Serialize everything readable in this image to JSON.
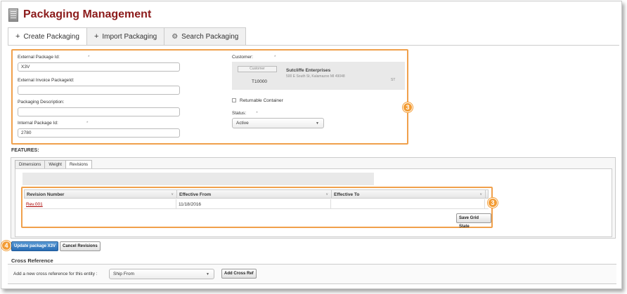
{
  "app": {
    "title": "Packaging Management",
    "logo_icon": "packaging-logo-icon"
  },
  "tabs": [
    {
      "label": "Create Packaging",
      "icon": "plus-icon"
    },
    {
      "label": "Import Packaging",
      "icon": "plus-icon"
    },
    {
      "label": "Search Packaging",
      "icon": "gear-icon"
    }
  ],
  "form": {
    "external_package_id": {
      "label": "External Package Id:",
      "required_mark": "*",
      "value": "X3V"
    },
    "external_invoice_package_id": {
      "label": "External Invoice PackageId:",
      "value": ""
    },
    "packaging_description": {
      "label": "Packaging Description:",
      "value": ""
    },
    "internal_package_id": {
      "label": "Internal Package Id:",
      "required_mark": "*",
      "value": "2780"
    },
    "customer": {
      "label": "Customer:",
      "required_mark": "*",
      "button_label": "Customer",
      "code": "T10000",
      "name": "Sutcliffe Enterprises",
      "address": "500 E South St, Kalamazoo MI 49048",
      "state": "ST"
    },
    "returnable_container": {
      "label": "Returnable Container",
      "checked": false
    },
    "status": {
      "label": "Status:",
      "required_mark": "*",
      "value": "Active"
    }
  },
  "badges": {
    "form": "3",
    "grid": "3",
    "update": "4"
  },
  "features": {
    "title": "FEATURES:",
    "tabs": [
      "Dimensions",
      "Weight",
      "Revisions"
    ],
    "active_tab": "Revisions",
    "grid": {
      "columns": [
        "Revision Number",
        "Effective From",
        "Effective To"
      ],
      "rows": [
        {
          "revision": "Rev.001",
          "effective_from": "11/18/2016",
          "effective_to": ""
        }
      ],
      "save_label": "Save Grid State"
    }
  },
  "actions": {
    "update_label": "Update package X3V",
    "cancel_label": "Cancel Revisions"
  },
  "cross_reference": {
    "title": "Cross Reference",
    "label": "Add a new cross reference for this entity :",
    "select_value": "Ship From",
    "button_label": "Add Cross Ref"
  },
  "colors": {
    "title": "#8b1a1a",
    "highlight": "#f0a04b",
    "badge": "#f39c34",
    "primary_button": "#2a6db5"
  }
}
